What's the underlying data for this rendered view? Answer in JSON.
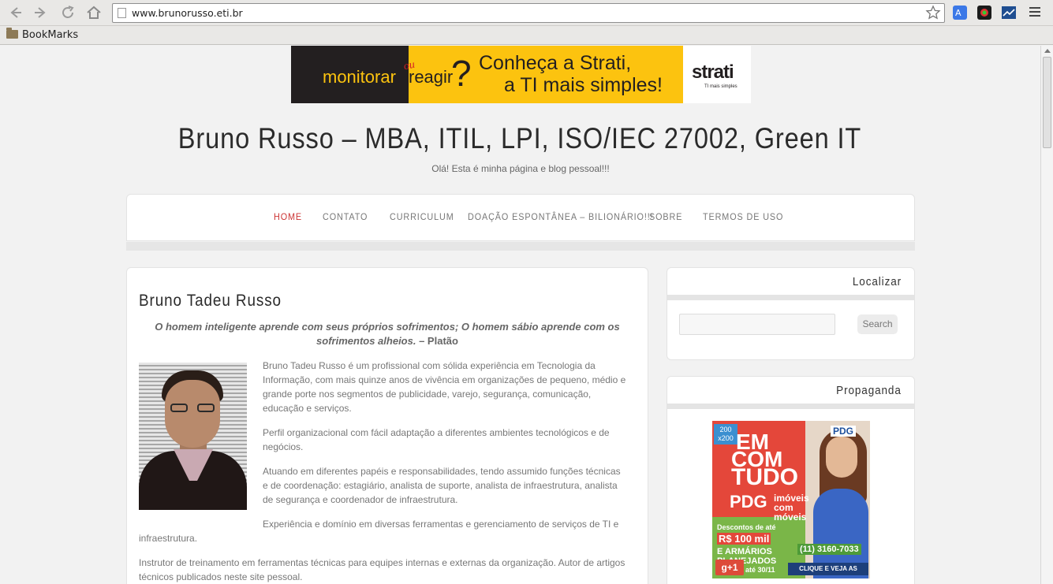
{
  "browser": {
    "url": "www.brunorusso.eti.br",
    "bookmarks_folder": "BookMarks",
    "icons": [
      "back-arrow-icon",
      "forward-arrow-icon",
      "reload-icon",
      "home-icon",
      "star-icon",
      "translate-icon",
      "extension-icon",
      "chart-extension-icon",
      "menu-icon",
      "page-icon",
      "folder-icon"
    ]
  },
  "banner_ad": {
    "word1": "monitorar",
    "ou": "ou",
    "word2": "reagir",
    "question": "?",
    "line1": "Conheça a Strati,",
    "line2": "a TI mais simples!",
    "brand": "strati",
    "tagline": "TI mais simples",
    "colors": {
      "yellow": "#fcc30f",
      "dark": "#231f20"
    }
  },
  "site": {
    "title": "Bruno Russo – MBA, ITIL, LPI, ISO/IEC 27002, Green IT",
    "tagline": "Olá! Esta é minha página e blog pessoal!!!"
  },
  "menu": {
    "items": [
      {
        "label": "HOME",
        "active": true
      },
      {
        "label": "CONTATO"
      },
      {
        "label": "CURRICULUM"
      },
      {
        "label": "DOAÇÃO ESPONTÂNEA – BILIONÁRIO!!!"
      },
      {
        "label": "SOBRE"
      },
      {
        "label": "TERMOS DE USO"
      }
    ],
    "active_color": "#cc3333"
  },
  "post": {
    "title": "Bruno Tadeu Russo",
    "quote": "O homem inteligente aprende com seus próprios sofrimentos; O homem sábio aprende com os sofrimentos alheios.",
    "quote_author": "– Platão",
    "paragraphs": [
      "Bruno Tadeu Russo é um profissional com sólida experiência em Tecnologia da Informação, com mais quinze anos de vivência em organizações de pequeno, médio e grande porte nos segmentos de publicidade, varejo, segurança, comunicação, educação e serviços.",
      "Perfil organizacional com fácil adaptação a diferentes ambientes tecnológicos e de negócios.",
      "Atuando em diferentes papéis e responsabilidades, tendo assumido funções técnicas e de coordenação: estagiário, analista de suporte, analista de infraestrutura, analista de segurança e coordenador de infraestrutura.",
      "Experiência e domínio em diversas ferramentas e gerenciamento de serviços de TI e infraestrutura.",
      "Instrutor de treinamento em ferramentas técnicas para equipes internas e externas da organização. Autor de artigos técnicos publicados neste site pessoal."
    ]
  },
  "sidebar": {
    "search_widget": {
      "title": "Localizar",
      "placeholder": "",
      "button": "Search"
    },
    "ad_widget": {
      "title": "Propaganda"
    }
  },
  "sidebar_ad": {
    "size_badge": "200 x200",
    "em": "EM",
    "com": "COM",
    "tudo": "TUDO",
    "pdg": "PDG",
    "imoveis": "imóveis com móveis",
    "logo": "PDG",
    "desc1": "Descontos de até",
    "desc2": "R$ 100 mil",
    "desc3": "E ARMÁRIOS PLANEJADOS",
    "phone": "(11) 3160-7033",
    "gplus": "g+1",
    "ate": "até 30/11",
    "cta": "CLIQUE E VEJA AS OFERTAS"
  }
}
